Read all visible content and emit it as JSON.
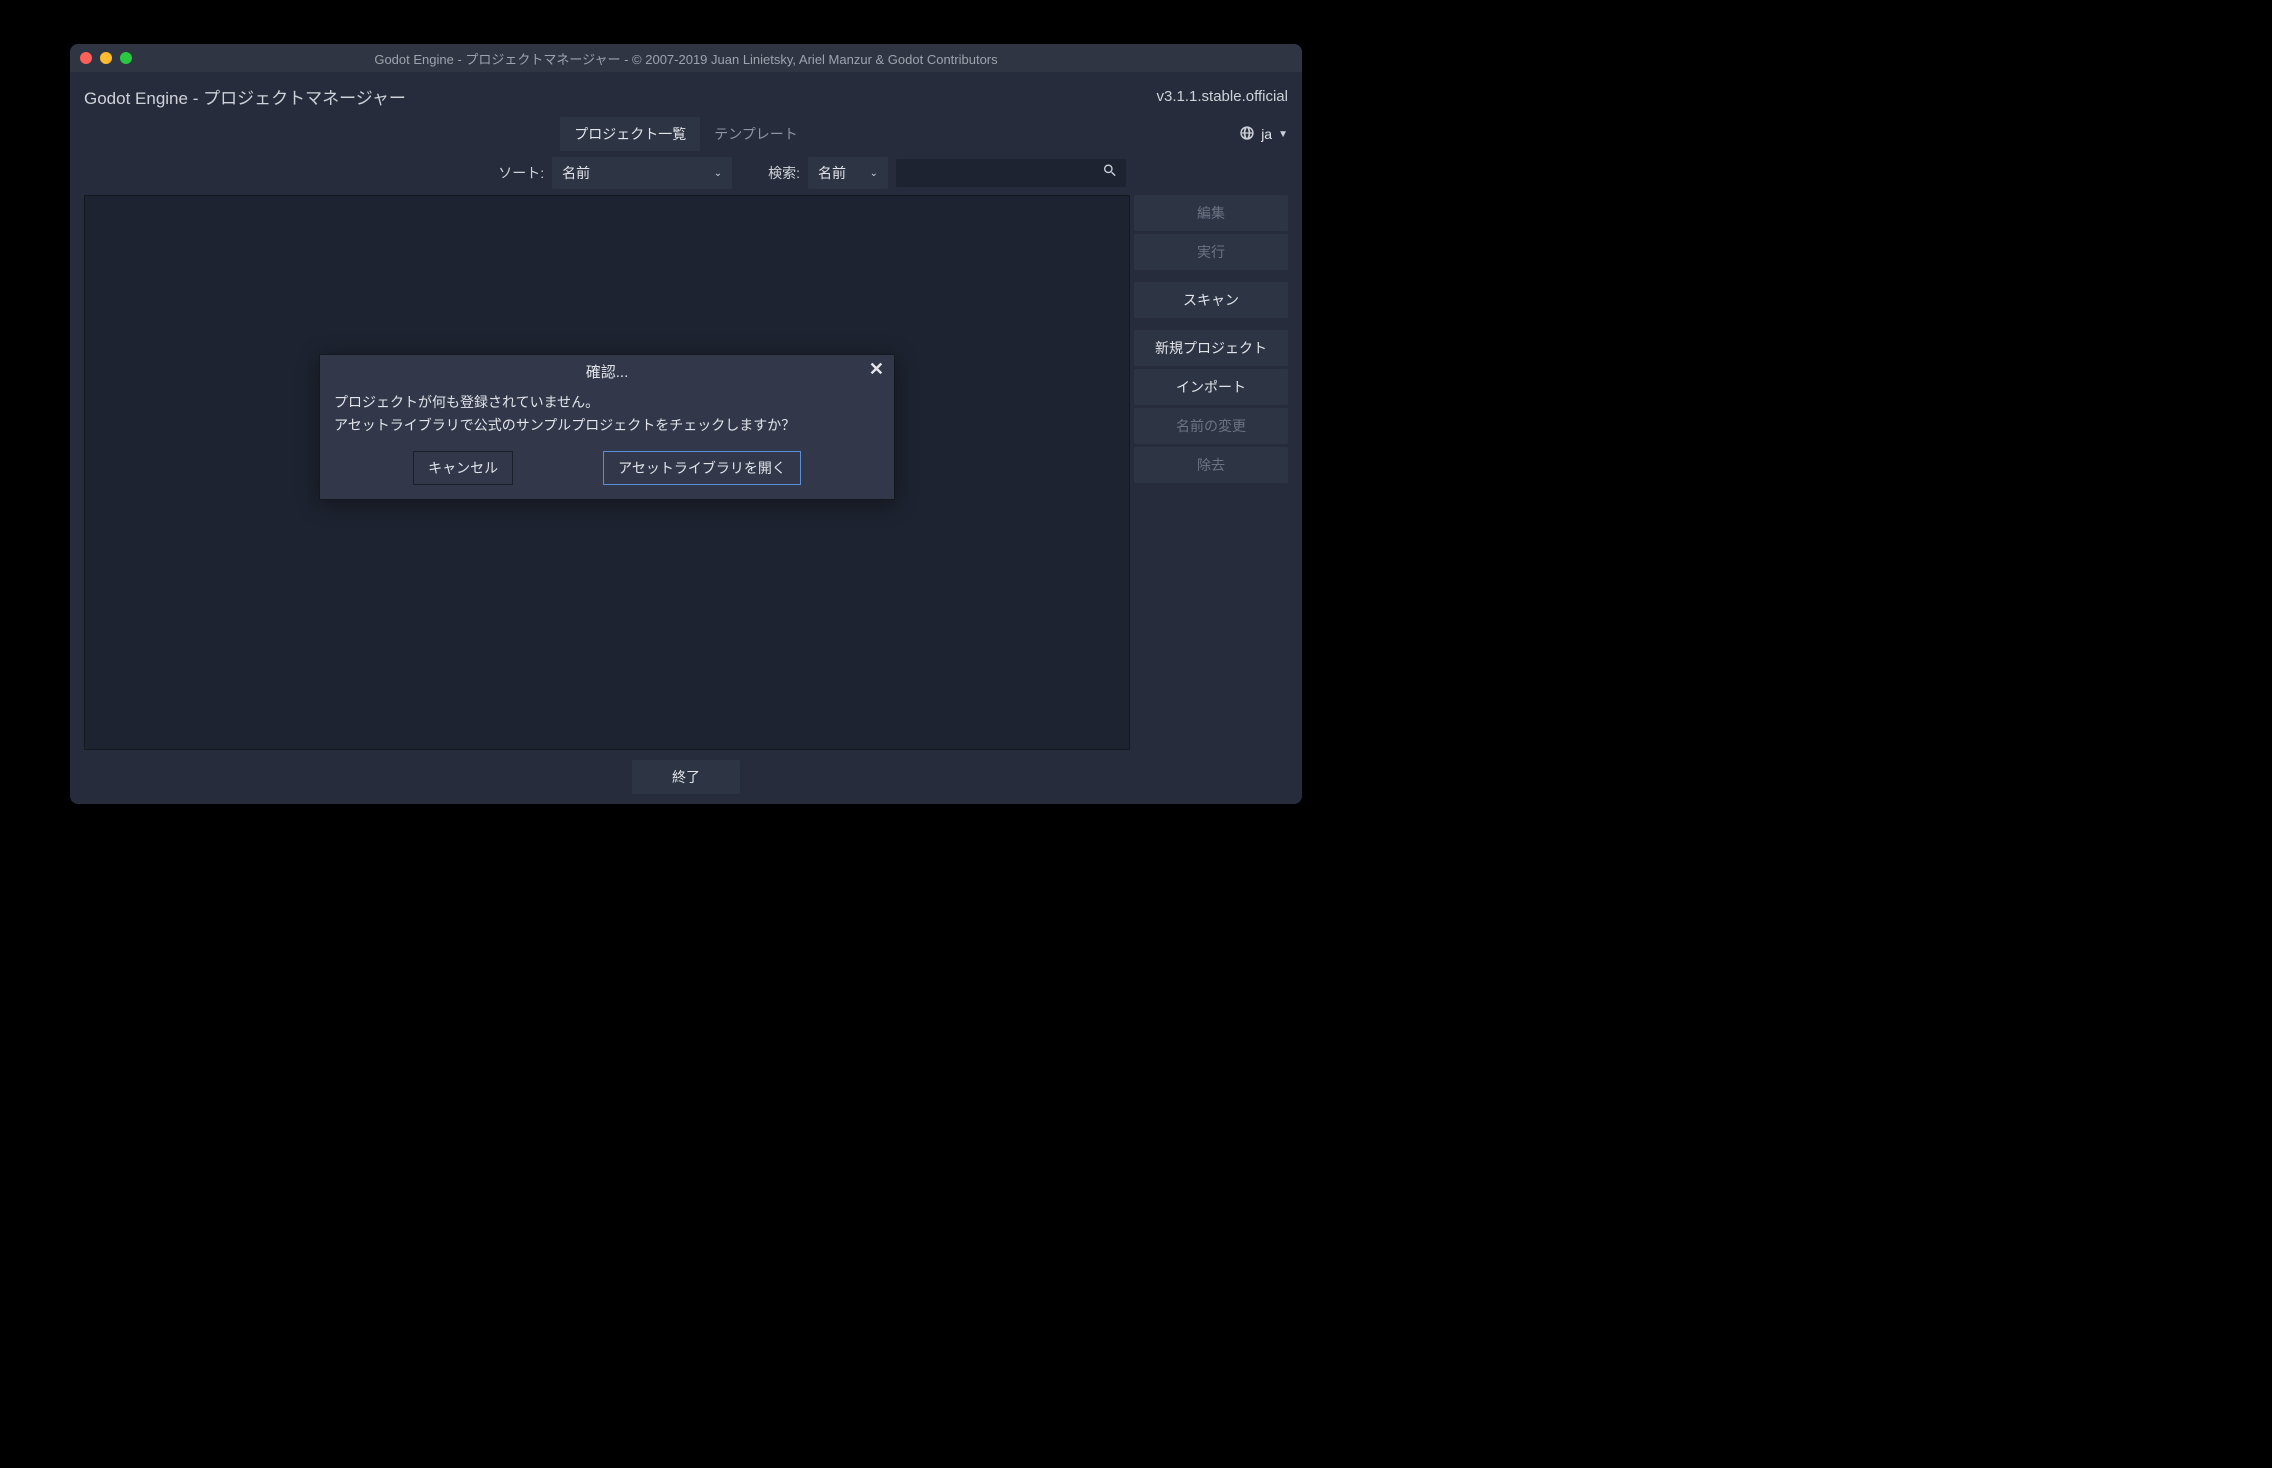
{
  "titlebar": "Godot Engine - プロジェクトマネージャー - © 2007-2019 Juan Linietsky, Ariel Manzur & Godot Contributors",
  "header": {
    "title": "Godot Engine - プロジェクトマネージャー",
    "version": "v3.1.1.stable.official"
  },
  "tabs": {
    "projects": "プロジェクト一覧",
    "templates": "テンプレート"
  },
  "lang": "ja",
  "toolbar": {
    "sort_label": "ソート:",
    "sort_value": "名前",
    "search_label": "検索:",
    "search_field_value": "名前"
  },
  "sidebar": {
    "edit": "編集",
    "run": "実行",
    "scan": "スキャン",
    "new_project": "新規プロジェクト",
    "import": "インポート",
    "rename": "名前の変更",
    "remove": "除去"
  },
  "footer": {
    "quit": "終了"
  },
  "dialog": {
    "title": "確認...",
    "line1": "プロジェクトが何も登録されていません。",
    "line2": "アセットライブラリで公式のサンプルプロジェクトをチェックしますか？",
    "cancel": "キャンセル",
    "open": "アセットライブラリを開く"
  }
}
